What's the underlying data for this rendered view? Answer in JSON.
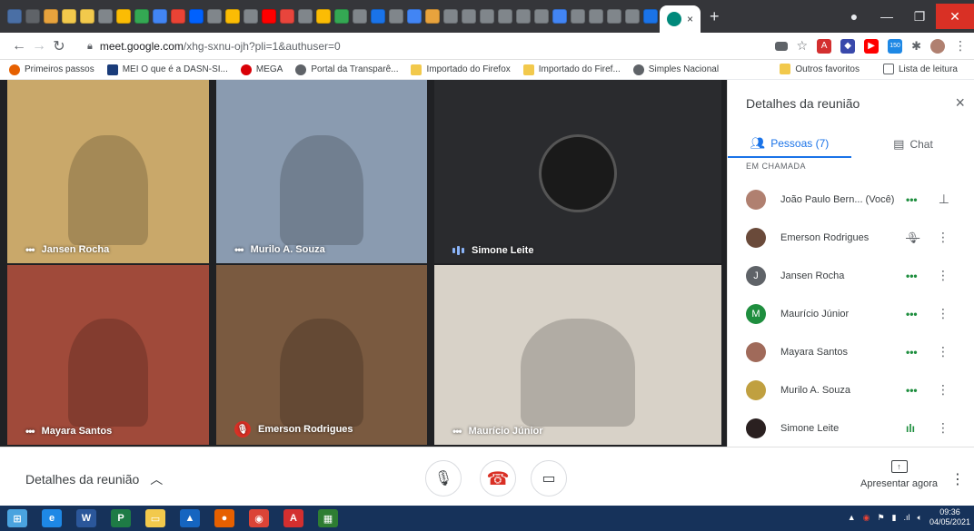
{
  "browser": {
    "tab_icons": [
      {
        "icon": "dasn-icon",
        "color": "#4a6fa5"
      },
      {
        "icon": "card-icon",
        "color": "#5f6368"
      },
      {
        "icon": "money-icon",
        "color": "#e8a33d"
      },
      {
        "icon": "doc-icon",
        "color": "#f2c94c"
      },
      {
        "icon": "doc-icon",
        "color": "#f2c94c"
      },
      {
        "icon": "globe-icon",
        "color": "#80868b"
      },
      {
        "icon": "drive-icon",
        "color": "#fbbc04"
      },
      {
        "icon": "drive-icon",
        "color": "#34a853"
      },
      {
        "icon": "search-icon",
        "color": "#4285f4"
      },
      {
        "icon": "gmail-icon",
        "color": "#ea4335"
      },
      {
        "icon": "dropbox-icon",
        "color": "#0061fe"
      },
      {
        "icon": "globe-icon",
        "color": "#80868b"
      },
      {
        "icon": "drive-icon",
        "color": "#fbbc04"
      },
      {
        "icon": "globe-icon",
        "color": "#80868b"
      },
      {
        "icon": "youtube-icon",
        "color": "#ff0000"
      },
      {
        "icon": "app-icon",
        "color": "#e8453c"
      },
      {
        "icon": "globe-icon",
        "color": "#80868b"
      },
      {
        "icon": "drive-icon",
        "color": "#fbbc04"
      },
      {
        "icon": "drive-icon",
        "color": "#34a853"
      },
      {
        "icon": "globe-icon",
        "color": "#80868b"
      },
      {
        "icon": "photo-icon",
        "color": "#1a73e8"
      },
      {
        "icon": "globe-icon",
        "color": "#80868b"
      },
      {
        "icon": "equals-icon",
        "color": "#4285f4"
      },
      {
        "icon": "money-icon",
        "color": "#e8a33d"
      },
      {
        "icon": "globe-icon",
        "color": "#80868b"
      },
      {
        "icon": "globe-icon",
        "color": "#80868b"
      },
      {
        "icon": "globe-icon",
        "color": "#80868b"
      },
      {
        "icon": "globe-icon",
        "color": "#80868b"
      },
      {
        "icon": "globe-icon",
        "color": "#80868b"
      },
      {
        "icon": "globe-icon",
        "color": "#80868b"
      },
      {
        "icon": "equals-icon",
        "color": "#4285f4"
      },
      {
        "icon": "globe-icon",
        "color": "#80868b"
      },
      {
        "icon": "globe-icon",
        "color": "#80868b"
      },
      {
        "icon": "globe-icon",
        "color": "#80868b"
      },
      {
        "icon": "globe-icon",
        "color": "#80868b"
      },
      {
        "icon": "calendar-icon",
        "color": "#1a73e8"
      }
    ],
    "active_tab_icon": "meet-icon",
    "active_tab_close": "×",
    "new_tab": "+",
    "url_host": "meet.google.com",
    "url_path": "/xhg-sxnu-ojh?pli=1&authuser=0"
  },
  "bookmarks": {
    "items": [
      {
        "label": "Primeiros passos",
        "icon": "firefox-icon",
        "color": "#e66000"
      },
      {
        "label": "MEI O que é a DASN-SI...",
        "icon": "mei-icon",
        "color": "#1a3c7a"
      },
      {
        "label": "MEGA",
        "icon": "mega-icon",
        "color": "#d90007"
      },
      {
        "label": "Portal da Transparê...",
        "icon": "globe-icon",
        "color": "#5f6368"
      },
      {
        "label": "Importado do Firefox",
        "icon": "folder-icon",
        "color": "#f2c94c"
      },
      {
        "label": "Importado do Firef...",
        "icon": "folder-icon",
        "color": "#f2c94c"
      },
      {
        "label": "Simples Nacional",
        "icon": "globe-icon",
        "color": "#5f6368"
      }
    ],
    "other": "Outros favoritos",
    "reading_list": "Lista de leitura"
  },
  "tiles": [
    {
      "name": "Jansen Rocha",
      "status": "dots",
      "bg": "#c9a86a"
    },
    {
      "name": "Murilo A. Souza",
      "status": "dots",
      "bg": "#8a9bb0"
    },
    {
      "name": "Simone Leite",
      "status": "speaking",
      "bg": "#2a2b2e"
    },
    {
      "name": "Mayara Santos",
      "status": "dots",
      "bg": "#a04a3a"
    },
    {
      "name": "Emerson Rodrigues",
      "status": "muted",
      "bg": "#7a5a40"
    },
    {
      "name": "Maurício Júnior",
      "status": "dots",
      "bg": "#d8d2c8"
    }
  ],
  "panel": {
    "title": "Detalhes da reunião",
    "close": "×",
    "tab_people": "Pessoas (7)",
    "tab_chat": "Chat",
    "section": "EM CHAMADA",
    "people": [
      {
        "name": "João Paulo Bern...  (Você)",
        "avatar": "photo",
        "avatar_color": "#b08070",
        "initial": "",
        "status": "dots",
        "action": "pin-icon"
      },
      {
        "name": "Emerson Rodrigues",
        "avatar": "photo",
        "avatar_color": "#6a4a3a",
        "initial": "",
        "status": "muted",
        "action": "more-icon"
      },
      {
        "name": "Jansen Rocha",
        "avatar": "initial",
        "avatar_color": "#5f6368",
        "initial": "J",
        "status": "dots",
        "action": "more-icon"
      },
      {
        "name": "Maurício Júnior",
        "avatar": "initial",
        "avatar_color": "#1e8e3e",
        "initial": "M",
        "status": "dots",
        "action": "more-icon"
      },
      {
        "name": "Mayara Santos",
        "avatar": "photo",
        "avatar_color": "#a06a5a",
        "initial": "",
        "status": "dots",
        "action": "more-icon"
      },
      {
        "name": "Murilo A. Souza",
        "avatar": "photo",
        "avatar_color": "#c0a040",
        "initial": "",
        "status": "dots",
        "action": "more-icon"
      },
      {
        "name": "Simone Leite",
        "avatar": "photo",
        "avatar_color": "#2a2020",
        "initial": "",
        "status": "speaking",
        "action": "more-icon"
      }
    ]
  },
  "bottom": {
    "meeting_details": "Detalhes da reunião",
    "present_label": "Apresentar agora"
  },
  "taskbar": {
    "apps": [
      {
        "icon": "windows-icon",
        "color": "#4aa3df",
        "glyph": "⊞"
      },
      {
        "icon": "ie-icon",
        "color": "#1e88e5",
        "glyph": "e"
      },
      {
        "icon": "word-icon",
        "color": "#2b579a",
        "glyph": "W"
      },
      {
        "icon": "publisher-icon",
        "color": "#1e7b45",
        "glyph": "P"
      },
      {
        "icon": "explorer-icon",
        "color": "#f2c94c",
        "glyph": "▭"
      },
      {
        "icon": "onedrive-icon",
        "color": "#1565c0",
        "glyph": "▲"
      },
      {
        "icon": "firefox-icon",
        "color": "#e66000",
        "glyph": "●"
      },
      {
        "icon": "chrome-icon",
        "color": "#db4437",
        "glyph": "◉"
      },
      {
        "icon": "acrobat-icon",
        "color": "#d32f2f",
        "glyph": "A"
      },
      {
        "icon": "calculator-icon",
        "color": "#2e7d32",
        "glyph": "▦"
      }
    ],
    "time": "09:36",
    "date": "04/05/2021"
  }
}
